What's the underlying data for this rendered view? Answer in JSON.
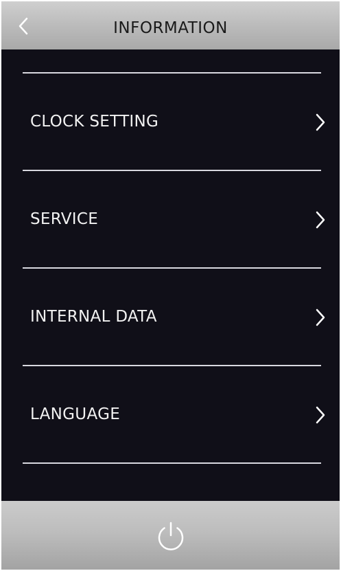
{
  "header": {
    "title": "INFORMATION",
    "back_icon": "chevron-left-icon"
  },
  "menu": {
    "items": [
      {
        "label": "CLOCK SETTING",
        "icon": "chevron-right-icon"
      },
      {
        "label": "SERVICE",
        "icon": "chevron-right-icon"
      },
      {
        "label": "INTERNAL DATA",
        "icon": "chevron-right-icon"
      },
      {
        "label": "LANGUAGE",
        "icon": "chevron-right-icon"
      }
    ]
  },
  "footer": {
    "power_icon": "power-icon"
  },
  "colors": {
    "background": "#100f18",
    "bar_gray": "#bdbdbd",
    "text_light": "#f2f2f2",
    "divider": "#d9d9e0"
  }
}
